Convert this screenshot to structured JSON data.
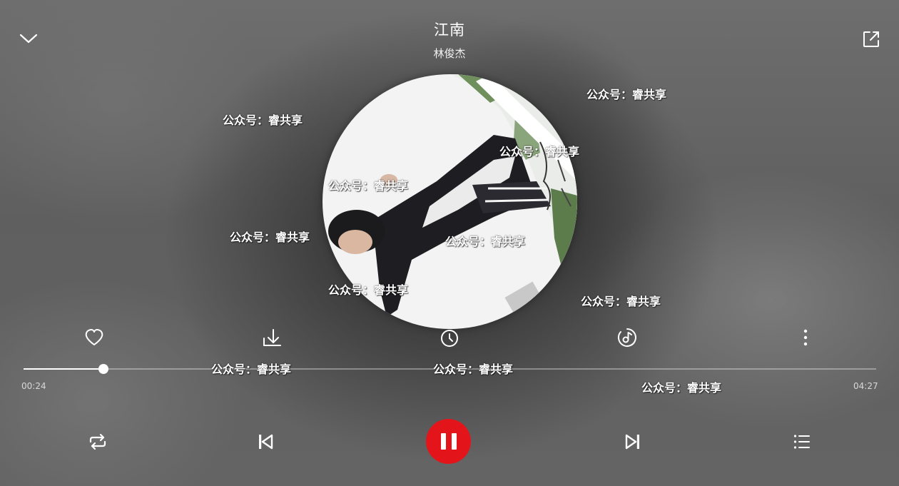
{
  "song": {
    "title": "江南",
    "artist": "林俊杰"
  },
  "header": {
    "collapse_icon": "chevron-down-icon",
    "share_icon": "external-share-icon"
  },
  "actions": [
    {
      "name": "like-button",
      "icon": "heart-icon"
    },
    {
      "name": "download-button",
      "icon": "download-icon"
    },
    {
      "name": "timer-button",
      "icon": "clock-icon"
    },
    {
      "name": "sound-effect-button",
      "icon": "music-note-icon"
    },
    {
      "name": "more-button",
      "icon": "more-vertical-icon"
    }
  ],
  "progress": {
    "current_time": "00:24",
    "total_time": "04:27",
    "fraction": 0.0936
  },
  "controls": {
    "repeat_icon": "repeat-icon",
    "prev_icon": "skip-previous-icon",
    "play_state": "playing",
    "pause_icon": "pause-icon",
    "next_icon": "skip-next-icon",
    "playlist_icon": "playlist-icon"
  },
  "colors": {
    "accent": "#e3151a",
    "text": "#ffffff"
  },
  "watermark": {
    "text": "公众号：睿共享"
  }
}
